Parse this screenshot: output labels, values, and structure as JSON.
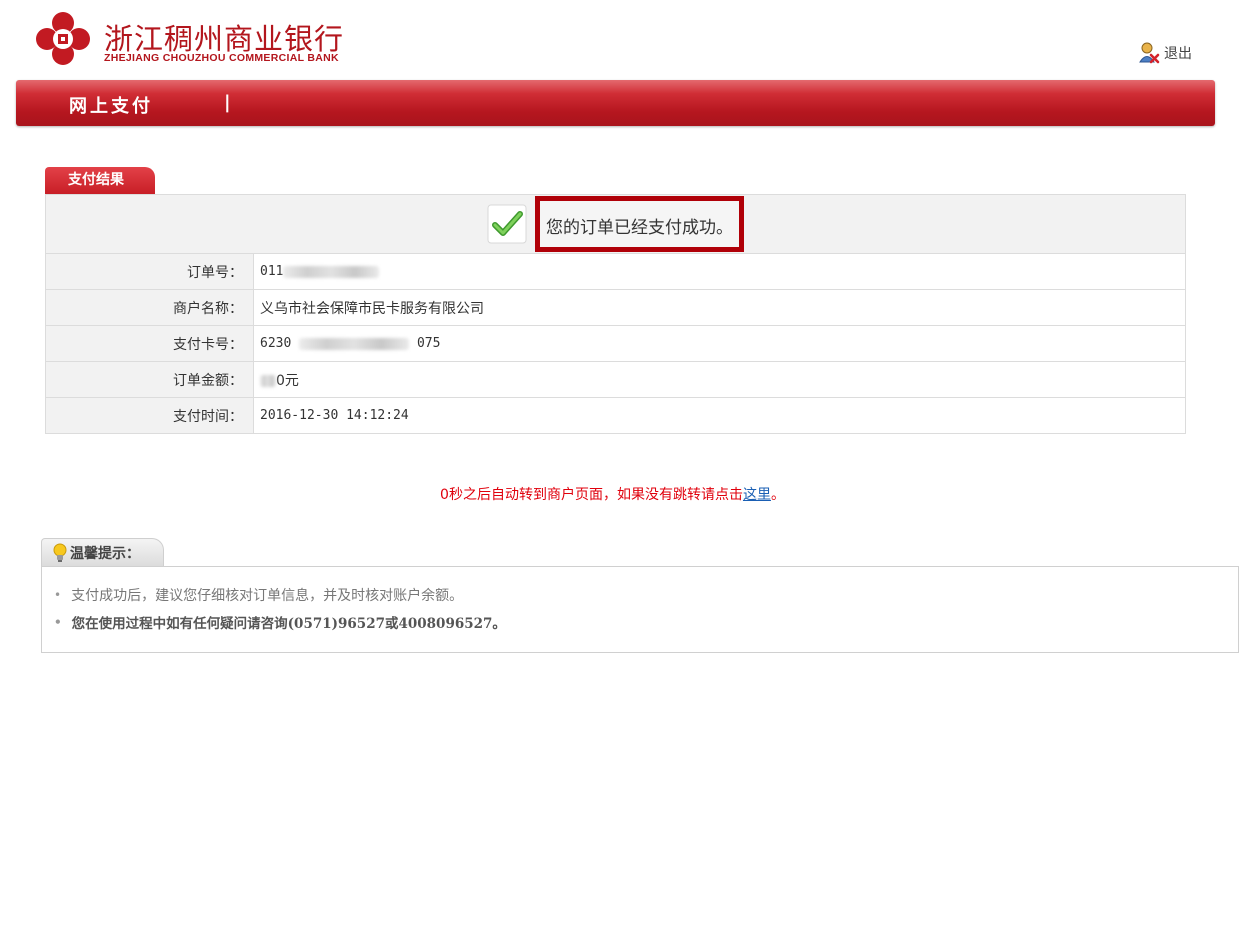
{
  "header": {
    "bank_name_cn": "浙江稠州商业银行",
    "bank_name_en": "ZHEJIANG CHOUZHOU COMMERCIAL BANK",
    "logo_icon": "bank-logo-icon",
    "logout_label": "退出",
    "logout_icon": "user-logout-icon"
  },
  "navbar": {
    "title": "网上支付",
    "separator": "|"
  },
  "result": {
    "tab_label": "支付结果",
    "success_icon": "check-icon",
    "message": "您的订单已经支付成功。",
    "rows": [
      {
        "label": "订单号：",
        "value_prefix": "011",
        "value_suffix": ""
      },
      {
        "label": "商户名称：",
        "value": "义乌市社会保障市民卡服务有限公司"
      },
      {
        "label": "支付卡号：",
        "value_prefix": "6230",
        "value_suffix": "075"
      },
      {
        "label": "订单金额：",
        "value_prefix": "",
        "value_suffix": "0元"
      },
      {
        "label": "支付时间：",
        "value": "2016-12-30 14:12:24"
      }
    ]
  },
  "redirect": {
    "text": "0秒之后自动转到商户页面，如果没有跳转请点击",
    "link": "这里",
    "end": "。"
  },
  "tips": {
    "title": "温馨提示：",
    "icon": "lightbulb-icon",
    "items": [
      "支付成功后，建议您仔细核对订单信息，并及时核对账户余额。",
      "您在使用过程中如有任何疑问请咨询(0571)96527或4008096527。"
    ]
  },
  "colors": {
    "brand_red": "#b3161d",
    "highlight_border": "#b00008",
    "redirect_text": "#e0000c",
    "link": "#1a5fb4"
  }
}
